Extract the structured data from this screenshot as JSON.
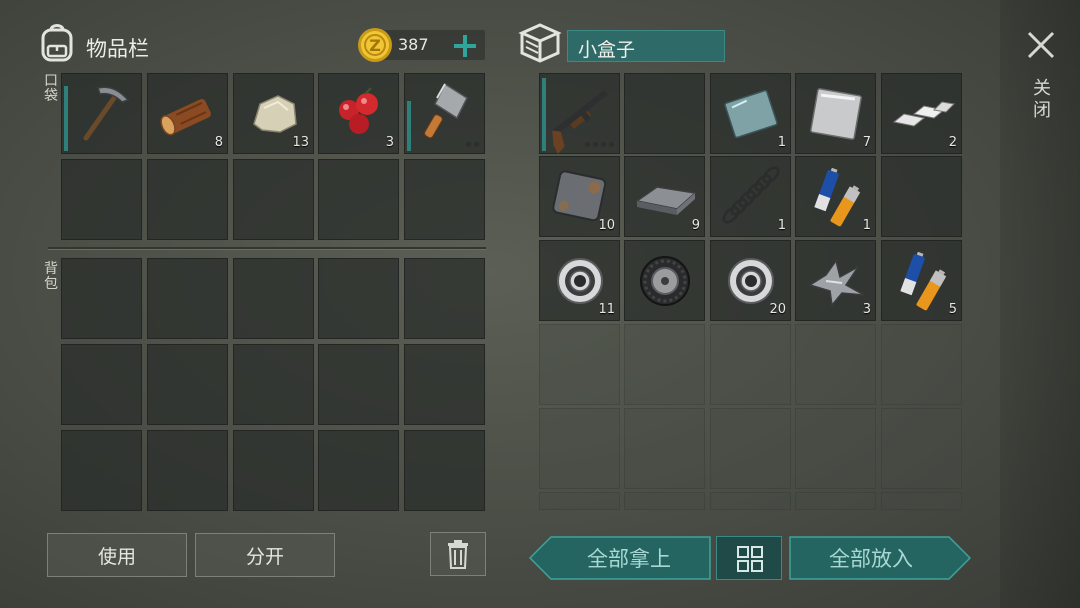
{
  "inventory": {
    "title": "物品栏",
    "coins": "387",
    "pocket_label": "口袋",
    "backpack_label": "背包",
    "pocket_slots": [
      {
        "item": "pickaxe-icon",
        "qty": "",
        "bar": 0.85
      },
      {
        "item": "log-icon",
        "qty": "8"
      },
      {
        "item": "stone-icon",
        "qty": "13"
      },
      {
        "item": "berries-icon",
        "qty": "3"
      },
      {
        "item": "cleaver-icon",
        "qty": "",
        "bar": 0.65
      }
    ]
  },
  "container": {
    "name": "小盒子",
    "slots": [
      {
        "item": "shotgun-icon",
        "qty": "",
        "bar": 0.95
      },
      {
        "item": "",
        "qty": ""
      },
      {
        "item": "glass-plate-icon",
        "qty": "1"
      },
      {
        "item": "metal-sheet-icon",
        "qty": "7"
      },
      {
        "item": "silver-ingot-icon",
        "qty": "2"
      },
      {
        "item": "rusty-plate-icon",
        "qty": "10"
      },
      {
        "item": "iron-bar-icon",
        "qty": "9"
      },
      {
        "item": "spring-icon",
        "qty": "1"
      },
      {
        "item": "battery-icon",
        "qty": "1"
      },
      {
        "item": "",
        "qty": ""
      },
      {
        "item": "bearing-icon",
        "qty": "11"
      },
      {
        "item": "tire-icon",
        "qty": ""
      },
      {
        "item": "bearing-icon",
        "qty": "20"
      },
      {
        "item": "metal-scrap-icon",
        "qty": "3"
      },
      {
        "item": "battery-icon",
        "qty": "5"
      }
    ]
  },
  "buttons": {
    "use": "使用",
    "split": "分开",
    "take_all": "全部拿上",
    "put_all": "全部放入"
  },
  "close_label": "关闭",
  "colors": {
    "accent": "#2e6a67",
    "accent_text": "#a9d8d4",
    "slot_bg": "#2a2e2b"
  }
}
